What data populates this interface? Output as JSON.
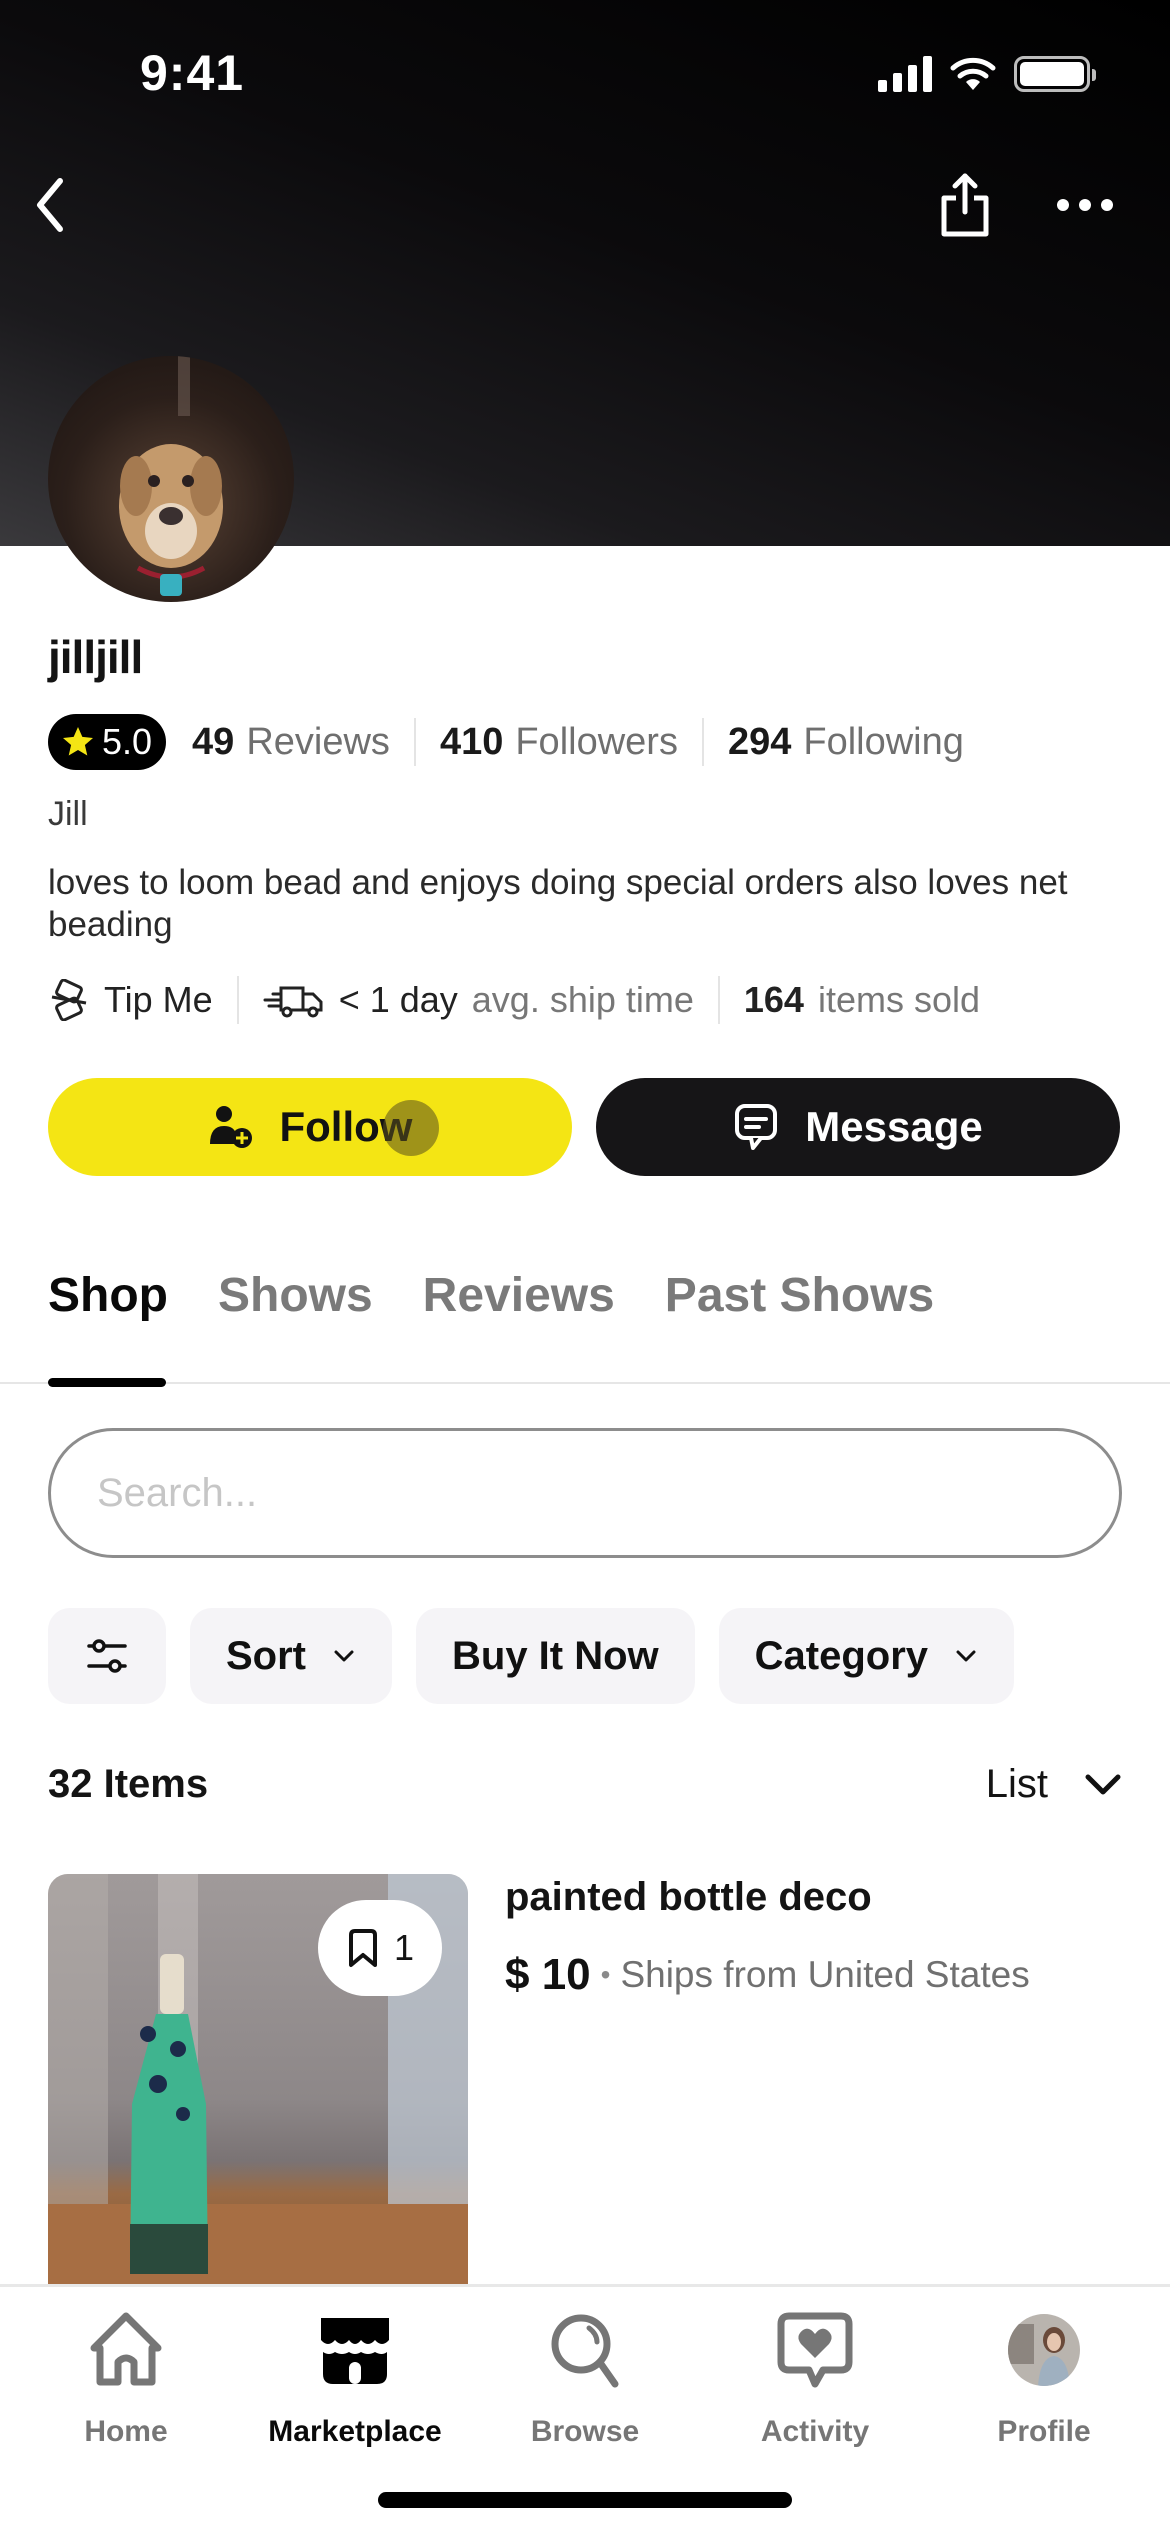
{
  "status_bar": {
    "time": "9:41"
  },
  "header": {
    "back_icon": "chevron-left-icon",
    "share_icon": "share-icon",
    "more_icon": "ellipsis-icon"
  },
  "profile": {
    "username": "jilljill",
    "rating": "5.0",
    "reviews_count": "49",
    "reviews_label": "Reviews",
    "followers_count": "410",
    "followers_label": "Followers",
    "following_count": "294",
    "following_label": "Following",
    "display_name": "Jill",
    "bio": "loves to loom bead and enjoys doing special orders also loves net beading",
    "tip_label": "Tip Me",
    "ship_time_value": "< 1 day",
    "ship_time_label": "avg. ship time",
    "items_sold_count": "164",
    "items_sold_label": "items sold"
  },
  "actions": {
    "follow_label": "Follow",
    "message_label": "Message"
  },
  "tabs": [
    {
      "label": "Shop",
      "active": true
    },
    {
      "label": "Shows",
      "active": false
    },
    {
      "label": "Reviews",
      "active": false
    },
    {
      "label": "Past Shows",
      "active": false
    }
  ],
  "search": {
    "placeholder": "Search..."
  },
  "filters": {
    "sort_label": "Sort",
    "buy_it_now_label": "Buy It Now",
    "category_label": "Category"
  },
  "results": {
    "count_label": "32 Items",
    "view_mode": "List"
  },
  "listings": [
    {
      "title": "painted bottle deco",
      "price": "$ 10",
      "separator": "•",
      "ships_from": "Ships from United States",
      "saves": "1"
    }
  ],
  "bottom_nav": [
    {
      "label": "Home",
      "icon": "home-icon",
      "active": false
    },
    {
      "label": "Marketplace",
      "icon": "storefront-icon",
      "active": true
    },
    {
      "label": "Browse",
      "icon": "search-icon",
      "active": false
    },
    {
      "label": "Activity",
      "icon": "heart-message-icon",
      "active": false
    },
    {
      "label": "Profile",
      "icon": "profile-avatar",
      "active": false
    }
  ],
  "colors": {
    "accent_yellow": "#f4e514",
    "dark_button": "#161517",
    "muted_text": "#767676"
  }
}
